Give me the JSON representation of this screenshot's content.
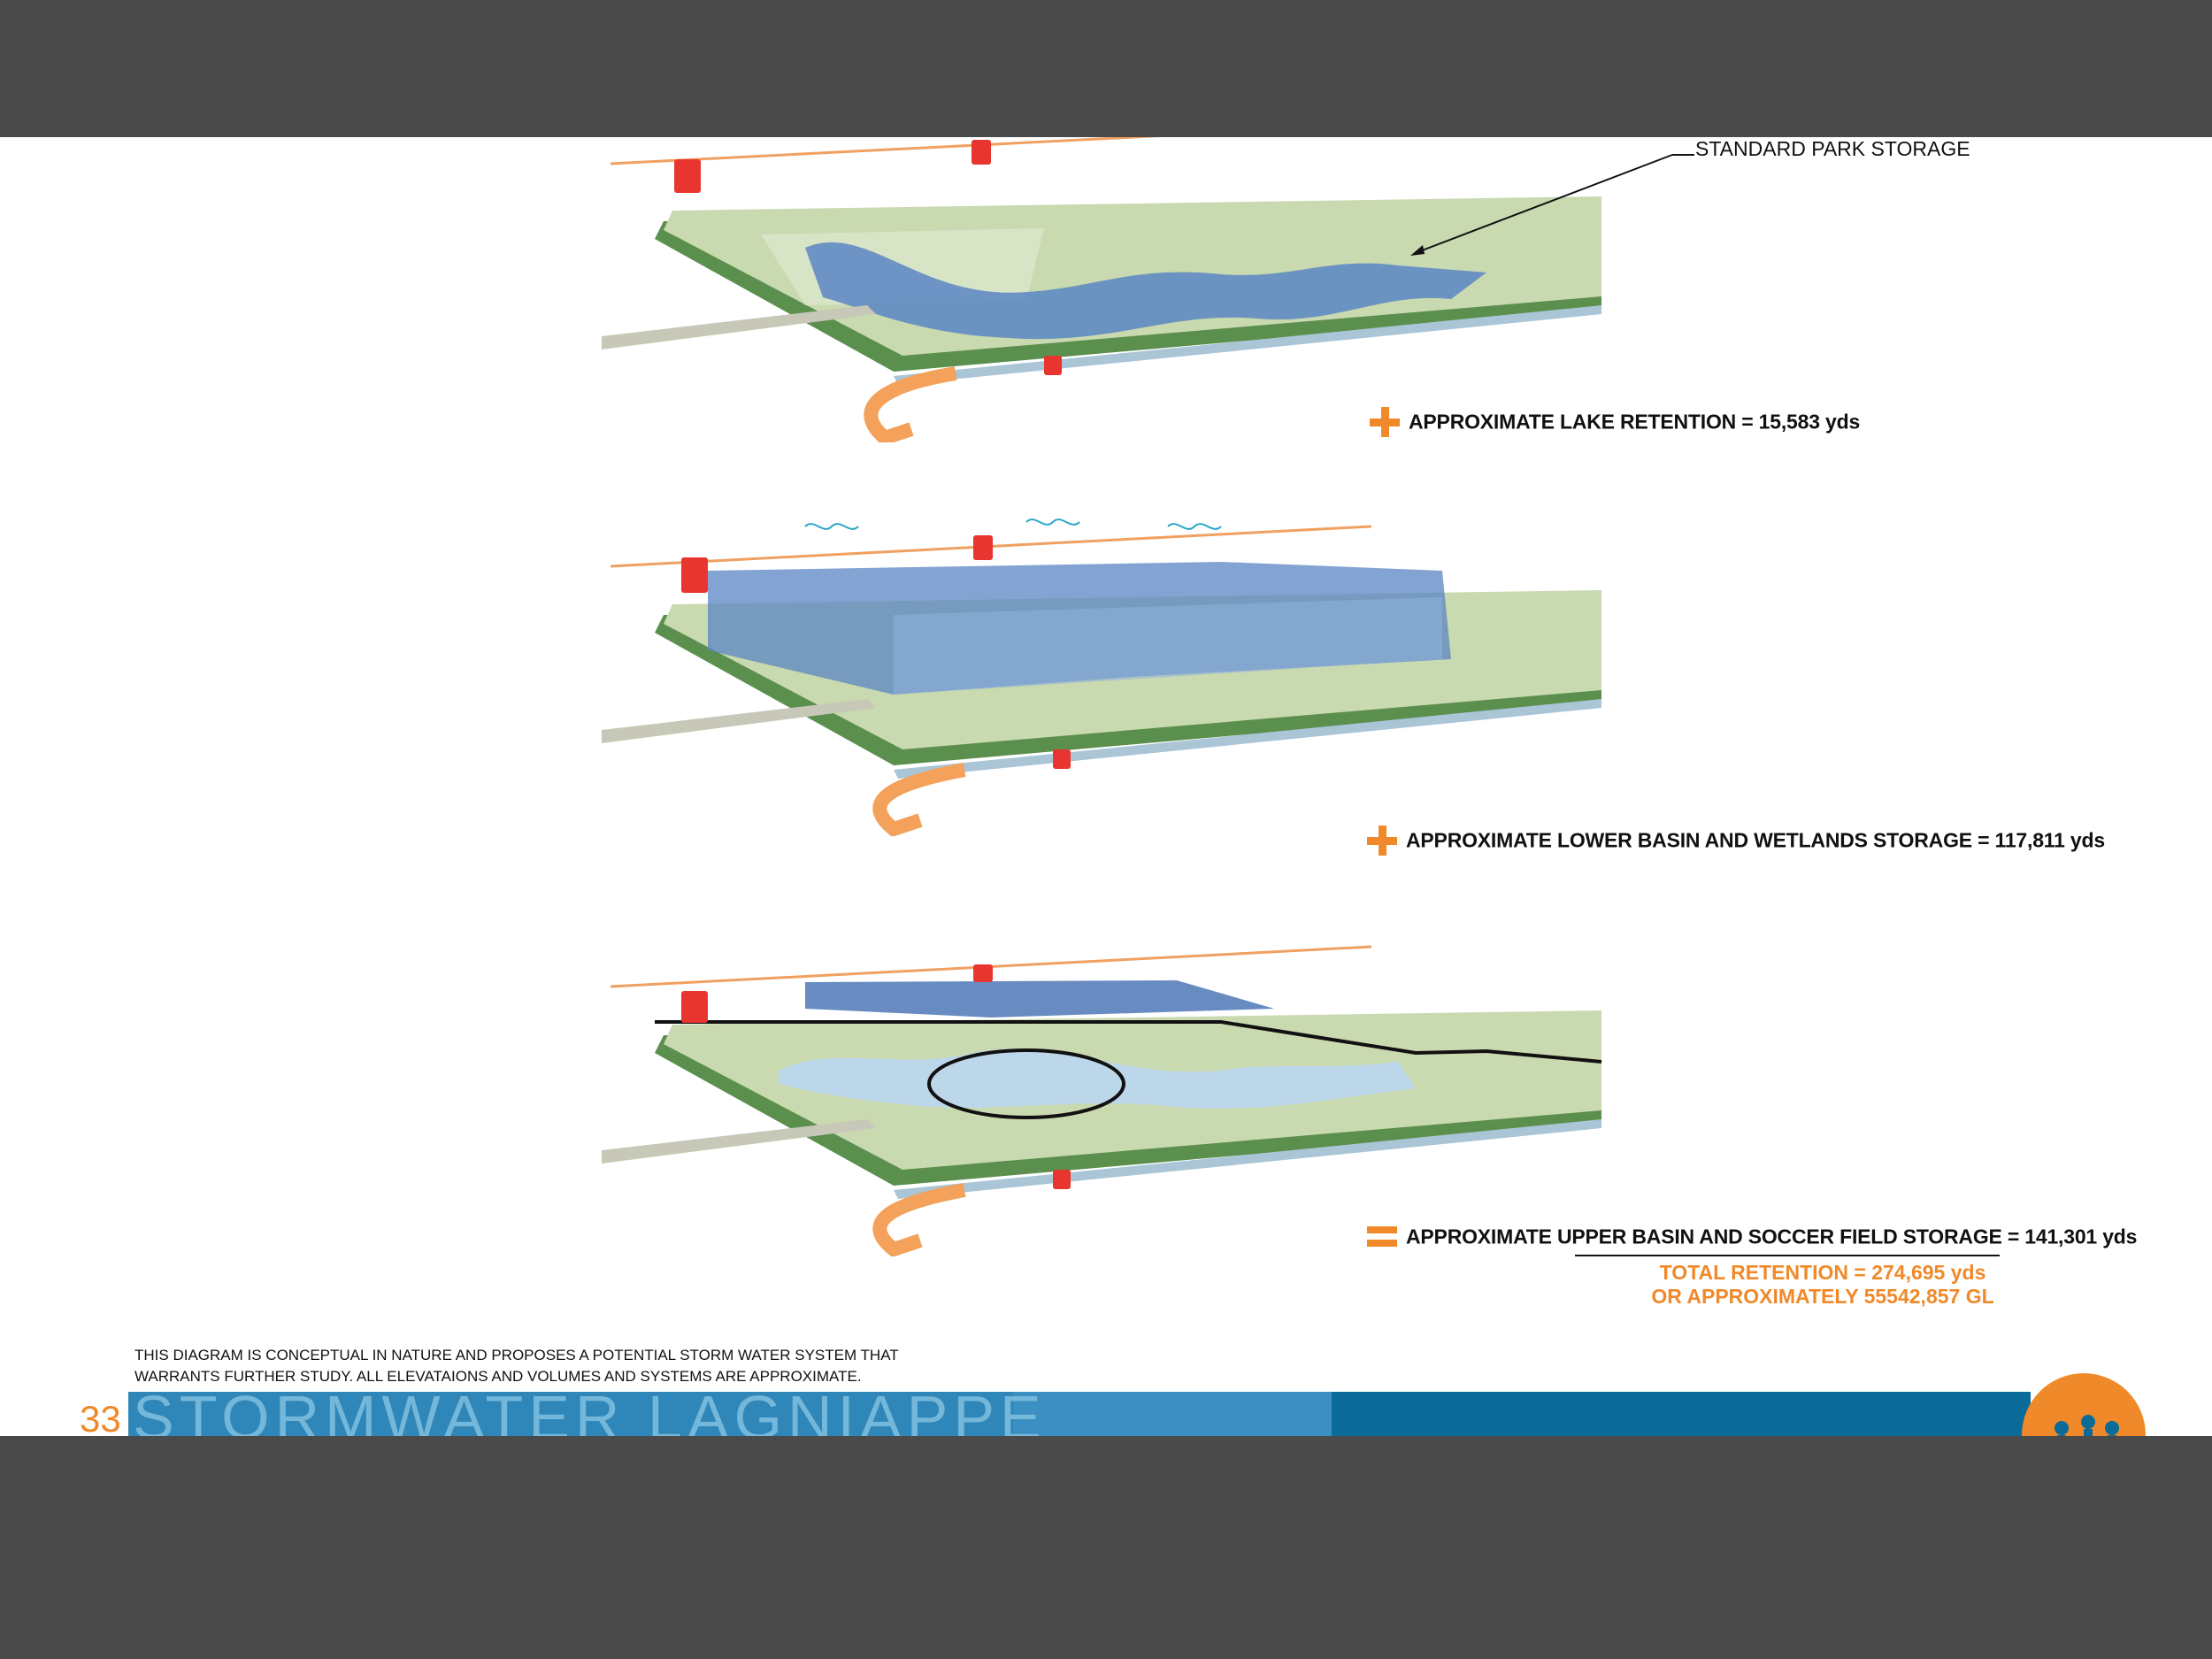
{
  "callout": {
    "standard_park_storage": "STANDARD PARK STORAGE"
  },
  "steps": [
    {
      "operator": "plus",
      "text": "APPROXIMATE LAKE RETENTION = 15,583 yds"
    },
    {
      "operator": "plus",
      "text": "APPROXIMATE LOWER BASIN AND WETLANDS STORAGE = 117,811 yds"
    },
    {
      "operator": "equals",
      "text": "APPROXIMATE UPPER BASIN AND SOCCER FIELD STORAGE = 141,301 yds"
    }
  ],
  "totals": {
    "line1": "TOTAL RETENTION = 274,695  yds",
    "line2": "OR APPROXIMATELY 55542,857 GL"
  },
  "disclaimer": {
    "line1": "THIS DIAGRAM IS CONCEPTUAL IN NATURE AND PROPOSES A POTENTIAL STORM WATER SYSTEM THAT",
    "line2": "WARRANTS FURTHER STUDY. ALL ELEVATAIONS AND VOLUMES AND SYSTEMS ARE APPROXIMATE."
  },
  "footer": {
    "page_number": "33",
    "title": "STORMWATER LAGNIAPPE"
  },
  "icons": [
    "plus-icon",
    "equals-icon",
    "flow-arrow-icon",
    "rain-squiggle-icon",
    "cistern-icon",
    "logo-icon"
  ],
  "colors": {
    "accent": "#f0892a",
    "water": "#5a86c4",
    "grass": "#b9d3a4",
    "edge": "#4e8a4e",
    "footer": "#0b6b98"
  }
}
